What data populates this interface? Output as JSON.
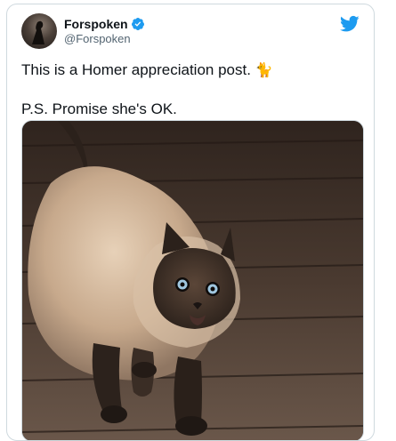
{
  "tweet": {
    "display_name": "Forspoken",
    "handle": "@Forspoken",
    "line1": "This is a Homer appreciation post.",
    "line1_emoji": "🐈",
    "line2": "P.S. Promise she's OK.",
    "accent_color": "#1d9bf0",
    "icons": [
      "verified-badge-icon",
      "twitter-bird-icon"
    ]
  }
}
